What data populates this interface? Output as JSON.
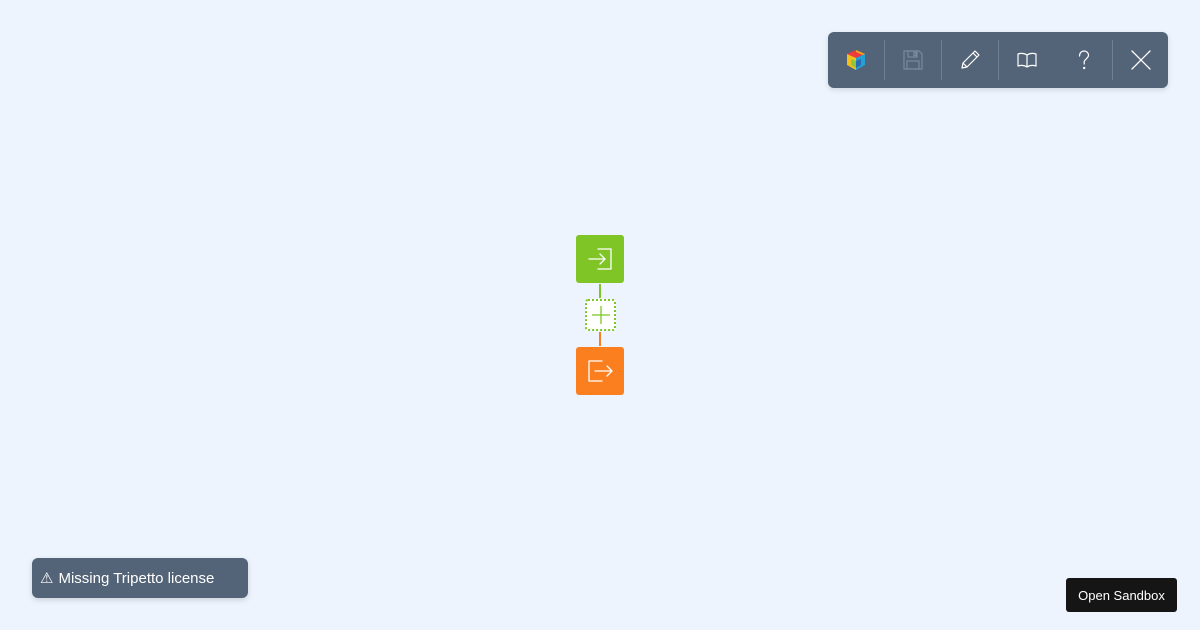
{
  "toolbar": {
    "buttons": [
      {
        "name": "tripetto-logo",
        "icon": "tripetto-logo-icon"
      },
      {
        "name": "save",
        "icon": "save-icon",
        "disabled": true
      },
      {
        "name": "edit",
        "icon": "pencil-icon"
      },
      {
        "name": "docs",
        "icon": "book-icon"
      },
      {
        "name": "help",
        "icon": "question-icon"
      },
      {
        "name": "close",
        "icon": "close-icon"
      }
    ],
    "color": "#536378"
  },
  "flow": {
    "start": {
      "icon": "enter-icon",
      "color": "#7fc526"
    },
    "add": {
      "icon": "plus-icon",
      "color": "#7fc526"
    },
    "end": {
      "icon": "exit-icon",
      "color": "#fb7f1f"
    }
  },
  "license": {
    "icon": "⚠",
    "text": "Missing Tripetto license"
  },
  "sandbox": {
    "label": "Open Sandbox"
  },
  "colors": {
    "background": "#edf4fd",
    "green": "#7fc526",
    "orange": "#fb7f1f"
  }
}
